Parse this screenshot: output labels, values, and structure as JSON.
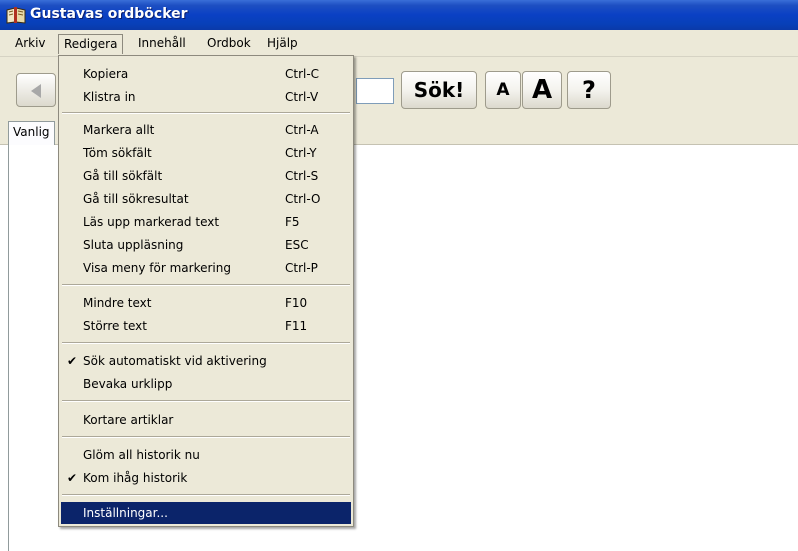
{
  "window": {
    "title": "Gustavas ordböcker"
  },
  "menubar": [
    {
      "label": "Arkiv"
    },
    {
      "label": "Redigera"
    },
    {
      "label": "Innehåll"
    },
    {
      "label": "Ordbok"
    },
    {
      "label": "Hjälp"
    }
  ],
  "toolbar": {
    "search_label": "Sök!",
    "font_smaller_label": "A",
    "font_larger_label": "A",
    "help_label": "?"
  },
  "tabs": {
    "active": "Vanlig"
  },
  "dropdown": {
    "items": [
      {
        "label": "Kopiera",
        "shortcut": "Ctrl-C",
        "checked": false
      },
      {
        "label": "Klistra in",
        "shortcut": "Ctrl-V",
        "checked": false
      },
      {
        "label": "Markera allt",
        "shortcut": "Ctrl-A",
        "checked": false
      },
      {
        "label": "Töm sökfält",
        "shortcut": "Ctrl-Y",
        "checked": false
      },
      {
        "label": "Gå till sökfält",
        "shortcut": "Ctrl-S",
        "checked": false
      },
      {
        "label": "Gå till sökresultat",
        "shortcut": "Ctrl-O",
        "checked": false
      },
      {
        "label": "Läs upp markerad text",
        "shortcut": "F5",
        "checked": false
      },
      {
        "label": "Sluta uppläsning",
        "shortcut": "ESC",
        "checked": false
      },
      {
        "label": "Visa meny för markering",
        "shortcut": "Ctrl-P",
        "checked": false
      },
      {
        "label": "Mindre text",
        "shortcut": "F10",
        "checked": false
      },
      {
        "label": "Större text",
        "shortcut": "F11",
        "checked": false
      },
      {
        "label": "Sök automatiskt vid aktivering",
        "shortcut": "",
        "checked": true
      },
      {
        "label": "Bevaka urklipp",
        "shortcut": "",
        "checked": false
      },
      {
        "label": "Kortare artiklar",
        "shortcut": "",
        "checked": false
      },
      {
        "label": "Glöm all historik nu",
        "shortcut": "",
        "checked": false
      },
      {
        "label": "Kom ihåg historik",
        "shortcut": "",
        "checked": true
      },
      {
        "label": "Inställningar...",
        "shortcut": "",
        "checked": false,
        "highlighted": true
      }
    ],
    "check_glyph": "✔"
  },
  "colors": {
    "titlebar": "#0a40c4",
    "menu_bg": "#ece9d8",
    "highlight": "#0b246a"
  }
}
